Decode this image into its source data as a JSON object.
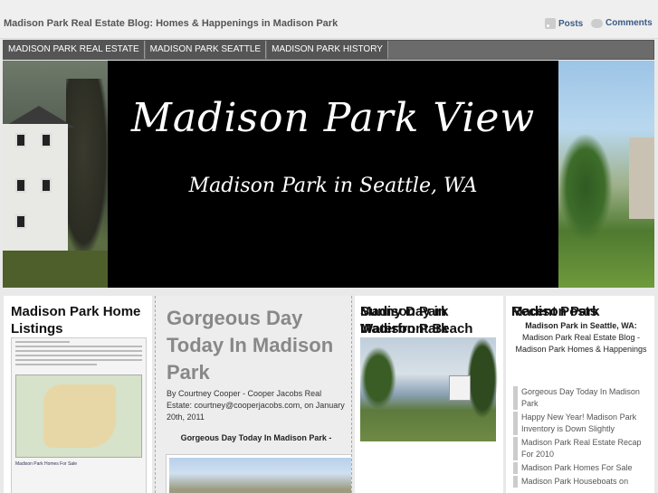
{
  "top": {
    "site_title": "Madison Park Real Estate Blog: Homes & Happenings in Madison Park",
    "feeds": {
      "posts": "Posts",
      "comments": "Comments"
    }
  },
  "nav": {
    "items": [
      {
        "label": "MADISON PARK REAL ESTATE"
      },
      {
        "label": "MADISON PARK SEATTLE"
      },
      {
        "label": "MADISON PARK HISTORY"
      }
    ]
  },
  "header": {
    "title": "Madison Park View",
    "subtitle": "Madison Park in Seattle, WA"
  },
  "col1": {
    "widget_title": "Madison Park Home Listings",
    "listing_caption": "Madison Park Homes For Sale"
  },
  "post": {
    "title": "Gorgeous Day Today In Madison Park",
    "byline": "By Courtney Cooper - Cooper Jacobs Real Estate: courtney@cooperjacobs.com, on January 20th, 2011",
    "excerpt": "Gorgeous Day Today In Madison Park -"
  },
  "col3": {
    "widget_title": "Madison Park Waterfront Beach",
    "next_title": "Sunny Day in Madison Park"
  },
  "col4": {
    "widget_title": "Madison Park",
    "about_sub": "Madison Park in Seattle, WA:",
    "about_text": "Madison Park Real Estate Blog - Madison Park Homes & Happenings",
    "recent_title": "Recent Posts",
    "recent": [
      "Gorgeous Day Today In Madison Park",
      "Happy New Year! Madison Park Inventory is Down Slightly",
      "Madison Park Real Estate Recap For 2010",
      "Madison Park Homes For Sale",
      "Madison Park Houseboats on"
    ]
  }
}
